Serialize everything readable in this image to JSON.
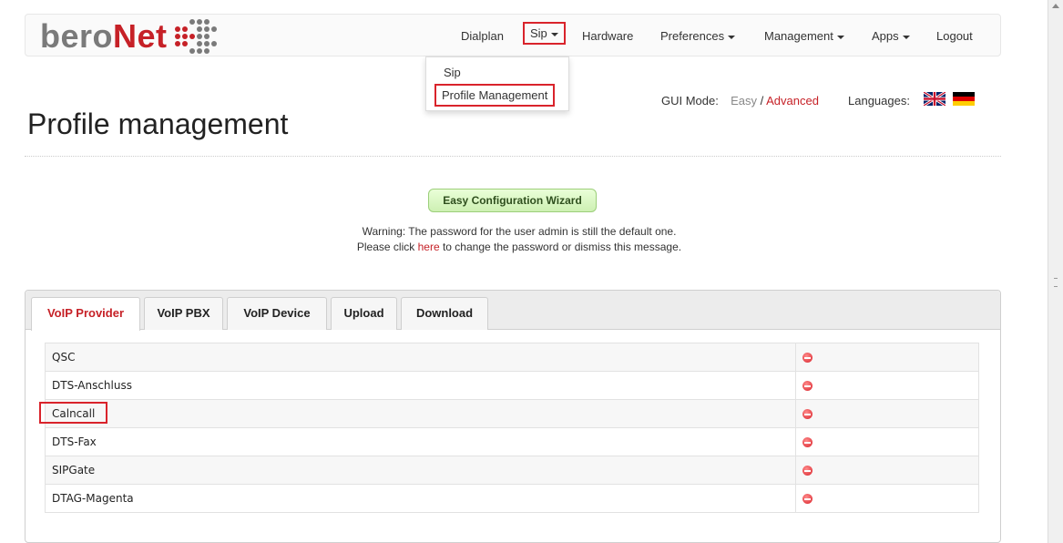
{
  "brand": {
    "logo_text_grey": "bero",
    "logo_text_red": "Net",
    "logo_dot_colors": [
      "#7a7a7a",
      "#c62127"
    ]
  },
  "nav": {
    "items": [
      {
        "label": "Dialplan"
      },
      {
        "label": "Sip"
      },
      {
        "label": "Hardware"
      },
      {
        "label": "Preferences"
      },
      {
        "label": "Management"
      },
      {
        "label": "Apps"
      },
      {
        "label": "Logout"
      }
    ]
  },
  "sip_dropdown": {
    "items": [
      {
        "label": "Sip"
      },
      {
        "label": "Profile Management"
      }
    ]
  },
  "gui_mode": {
    "label": "GUI Mode:",
    "easy": "Easy",
    "separator": " / ",
    "advanced": "Advanced"
  },
  "languages": {
    "label": "Languages:",
    "flags": [
      "uk-flag-icon",
      "germany-flag-icon"
    ]
  },
  "page": {
    "title": "Profile management"
  },
  "wizard": {
    "label": "Easy Configuration Wizard"
  },
  "warning": {
    "line1": "Warning: The password for the user admin is still the default one.",
    "line2_before": "Please click ",
    "link": "here",
    "line2_after": " to change the password or dismiss this message."
  },
  "tabs": [
    {
      "label": "VoIP Provider",
      "active": true
    },
    {
      "label": "VoIP PBX"
    },
    {
      "label": "VoIP Device"
    },
    {
      "label": "Upload"
    },
    {
      "label": "Download"
    }
  ],
  "profiles": [
    {
      "name": "QSC"
    },
    {
      "name": "DTS-Anschluss"
    },
    {
      "name": "Calncall"
    },
    {
      "name": "DTS-Fax"
    },
    {
      "name": "SIPGate"
    },
    {
      "name": "DTAG-Magenta"
    }
  ],
  "colors": {
    "accent_red": "#c62127",
    "highlight_red": "#d9232b",
    "wizard_green": "#cdf0b3"
  }
}
